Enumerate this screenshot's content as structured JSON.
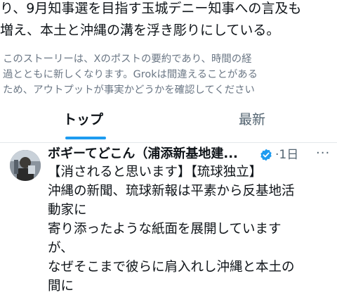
{
  "summary": {
    "lines": [
      "り、9月知事選を目指す玉城デニー知事への言及も",
      "増え、本土と沖縄の溝を浮き彫りにしている。"
    ]
  },
  "disclaimer": {
    "lines": [
      "このストーリーは、Xのポストの要約であり、時間の経",
      "過とともに新しくなります。Grokは間違えることがある",
      "ため、アウトプットが事実かどうかを確認してください"
    ]
  },
  "tabs": {
    "top": "トップ",
    "latest": "最新",
    "active": "top",
    "accent_color": "#1d9bf0"
  },
  "post": {
    "author_name": "ボギーてどこん（浦添新基地建...",
    "verified_icon": "verified-badge-icon",
    "separator": "·",
    "time": "1日",
    "more_icon": "more-options-icon",
    "lines": [
      "【消されると思います】【琉球独立】",
      "沖縄の新聞、琉球新報は平素から反基地活",
      "動家に",
      "寄り添ったような紙面を展開しています",
      "が、",
      "なぜそこまで彼らに肩入れし沖縄と本土の",
      "間に"
    ]
  }
}
